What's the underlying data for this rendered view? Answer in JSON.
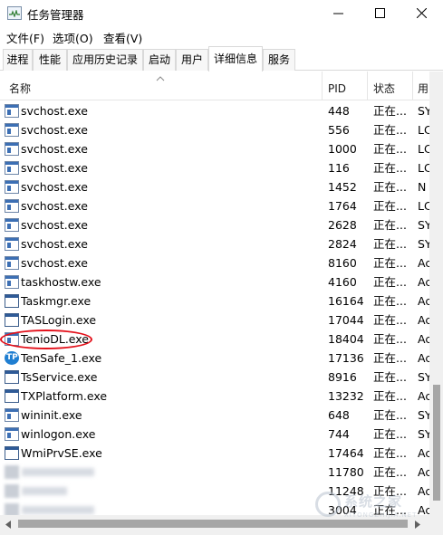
{
  "window": {
    "title": "任务管理器"
  },
  "menu": {
    "file": "文件(F)",
    "options": "选项(O)",
    "view": "查看(V)"
  },
  "tabs": [
    {
      "label": "进程"
    },
    {
      "label": "性能"
    },
    {
      "label": "应用历史记录"
    },
    {
      "label": "启动"
    },
    {
      "label": "用户"
    },
    {
      "label": "详细信息",
      "active": true
    },
    {
      "label": "服务"
    }
  ],
  "table": {
    "columns": {
      "name": "名称",
      "pid": "PID",
      "status": "状态",
      "user": "用"
    },
    "rows": [
      {
        "name": "svchost.exe",
        "pid": "448",
        "status": "正在...",
        "user": "SY",
        "icon": "service-icon"
      },
      {
        "name": "svchost.exe",
        "pid": "556",
        "status": "正在...",
        "user": "LC",
        "icon": "service-icon"
      },
      {
        "name": "svchost.exe",
        "pid": "1000",
        "status": "正在...",
        "user": "LC",
        "icon": "service-icon"
      },
      {
        "name": "svchost.exe",
        "pid": "116",
        "status": "正在...",
        "user": "LC",
        "icon": "service-icon"
      },
      {
        "name": "svchost.exe",
        "pid": "1452",
        "status": "正在...",
        "user": "N",
        "icon": "service-icon"
      },
      {
        "name": "svchost.exe",
        "pid": "1764",
        "status": "正在...",
        "user": "LC",
        "icon": "service-icon"
      },
      {
        "name": "svchost.exe",
        "pid": "2628",
        "status": "正在...",
        "user": "SY",
        "icon": "service-icon"
      },
      {
        "name": "svchost.exe",
        "pid": "2824",
        "status": "正在...",
        "user": "SY",
        "icon": "service-icon"
      },
      {
        "name": "svchost.exe",
        "pid": "8160",
        "status": "正在...",
        "user": "Ac",
        "icon": "service-icon"
      },
      {
        "name": "taskhostw.exe",
        "pid": "4160",
        "status": "正在...",
        "user": "Ac",
        "icon": "service-icon"
      },
      {
        "name": "Taskmgr.exe",
        "pid": "16164",
        "status": "正在...",
        "user": "Ac",
        "icon": "taskmgr-icon"
      },
      {
        "name": "TASLogin.exe",
        "pid": "17044",
        "status": "正在...",
        "user": "Ac",
        "icon": "window-icon"
      },
      {
        "name": "TenioDL.exe",
        "pid": "18404",
        "status": "正在...",
        "user": "Ac",
        "icon": "service-icon"
      },
      {
        "name": "TenSafe_1.exe",
        "pid": "17136",
        "status": "正在...",
        "user": "Ac",
        "icon": "tensafe-icon"
      },
      {
        "name": "TsService.exe",
        "pid": "8916",
        "status": "正在...",
        "user": "SY",
        "icon": "window-icon"
      },
      {
        "name": "TXPlatform.exe",
        "pid": "13232",
        "status": "正在...",
        "user": "Ac",
        "icon": "window-icon"
      },
      {
        "name": "wininit.exe",
        "pid": "648",
        "status": "正在...",
        "user": "SY",
        "icon": "service-icon"
      },
      {
        "name": "winlogon.exe",
        "pid": "744",
        "status": "正在...",
        "user": "SY",
        "icon": "service-icon"
      },
      {
        "name": "WmiPrvSE.exe",
        "pid": "17464",
        "status": "正在...",
        "user": "Ac",
        "icon": "wmi-icon"
      },
      {
        "name": "",
        "pid": "11780",
        "status": "正在...",
        "user": "Ac",
        "icon": "blurred-icon"
      },
      {
        "name": "",
        "pid": "11248",
        "status": "正在...",
        "user": "Ac",
        "icon": "blurred-icon"
      },
      {
        "name": "",
        "pid": "3004",
        "status": "正在...",
        "user": "Ac",
        "icon": "blurred-icon"
      }
    ]
  },
  "highlight": {
    "color": "#e3101a"
  },
  "watermark": {
    "text": "系统之家",
    "sub": "XITONGZHIJIA.NET"
  }
}
